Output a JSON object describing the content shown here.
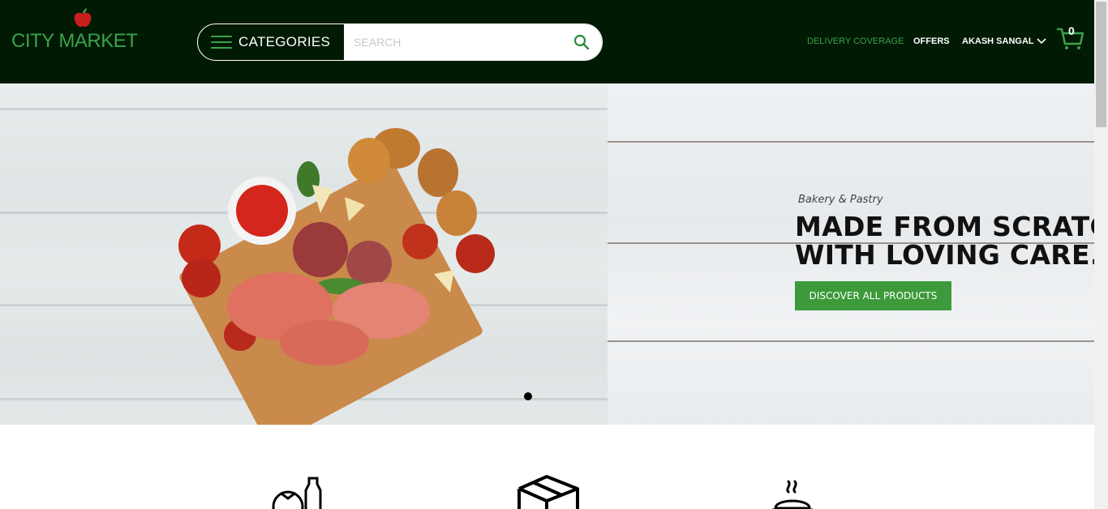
{
  "brand": {
    "name": "CITY MARKET"
  },
  "header": {
    "categories_label": "CATEGORIES",
    "search_placeholder": "SEARCH",
    "nav": {
      "delivery": "DELIVERY COVERAGE",
      "offers": "OFFERS",
      "user": "AKASH SANGAL"
    },
    "cart_count": "0"
  },
  "hero": {
    "subtitle": "Bakery & Pastry",
    "title_line1": "MADE FROM SCRATCH",
    "title_line2": "WITH LOVING CARE.",
    "cta": "DISCOVER ALL PRODUCTS"
  },
  "colors": {
    "header_bg": "#001a04",
    "accent_green": "#3aa34a",
    "cta_green": "#3d9a3a"
  },
  "icons": [
    "menu-icon",
    "search-icon",
    "chevron-down-icon",
    "cart-icon",
    "grocery-icon",
    "box-icon",
    "hot-food-icon"
  ]
}
